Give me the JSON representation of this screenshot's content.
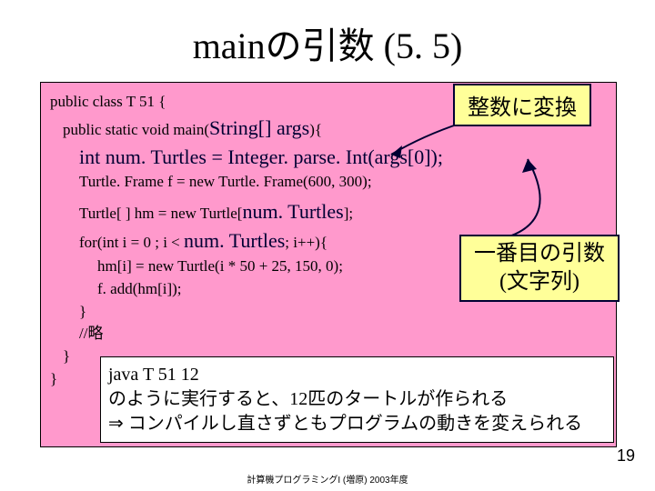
{
  "title": "mainの引数 (5. 5)",
  "code": {
    "l1a": "public class T 51 {",
    "l2a": "public static void main(",
    "l2b": "String[] args",
    "l2c": "){",
    "l3": "int num. Turtles = Integer. parse. Int(args[0]);",
    "l4": "Turtle. Frame f = new Turtle. Frame(600, 300);",
    "l5a": "Turtle[ ] hm = new Turtle[",
    "l5b": "num. Turtles",
    "l5c": "];",
    "l6a": "for(int i = 0 ; i < ",
    "l6b": "num. Turtles",
    "l6c": "; i++){",
    "l7": "hm[i] = new Turtle(i * 50 + 25, 150, 0);",
    "l8": "f. add(hm[i]);",
    "l9": "}",
    "l10": "//略",
    "l11": "}",
    "l12": "}"
  },
  "callout1": "整数に変換",
  "callout2_l1": "一番目の引数",
  "callout2_l2": "(文字列)",
  "note_l1": "java T 51 12",
  "note_l2": "のように実行すると、12匹のタートルが作られる",
  "note_l3a": "⇒",
  "note_l3b": " コンパイルし直さずともプログラムの動きを変えられる",
  "pagenum": "19",
  "footer": "計算機プログラミングI (増原) 2003年度"
}
